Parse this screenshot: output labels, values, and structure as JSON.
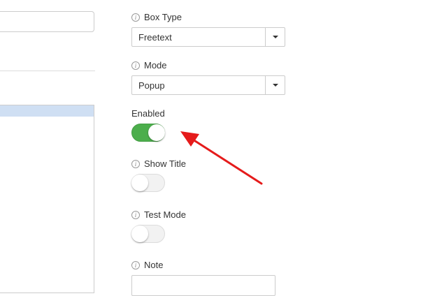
{
  "fields": {
    "box_type": {
      "label": "Box Type",
      "value": "Freetext"
    },
    "mode": {
      "label": "Mode",
      "value": "Popup"
    },
    "enabled": {
      "label": "Enabled",
      "state": "on"
    },
    "show_title": {
      "label": "Show Title",
      "state": "off"
    },
    "test_mode": {
      "label": "Test Mode",
      "state": "off"
    },
    "note": {
      "label": "Note",
      "value": ""
    }
  },
  "info_glyph": "i",
  "colors": {
    "toggle_on": "#4cae4c",
    "toggle_off": "#f2f2f2",
    "annotation_arrow": "#e51b1b",
    "selection_highlight": "#cfdff3"
  },
  "icons": [
    "info-icon",
    "chevron-down-icon",
    "annotation-arrow"
  ]
}
